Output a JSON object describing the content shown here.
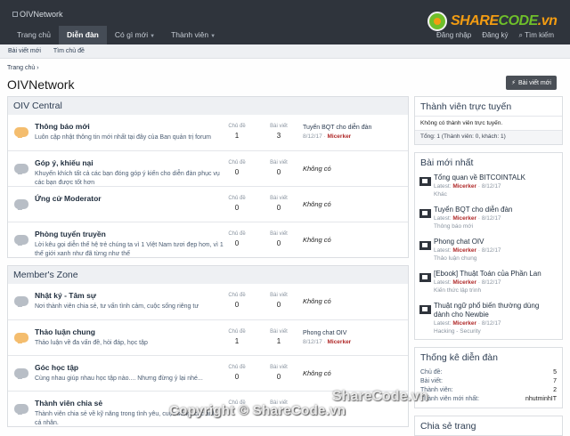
{
  "header": {
    "logo_alt": "OIVNetwork",
    "nav_tabs": [
      {
        "label": "Trang chủ",
        "active": false,
        "caret": false
      },
      {
        "label": "Diễn đàn",
        "active": true,
        "caret": false
      },
      {
        "label": "Có gì mới",
        "active": false,
        "caret": true
      },
      {
        "label": "Thành viên",
        "active": false,
        "caret": true
      }
    ],
    "login_label": "Đăng nhập",
    "register_label": "Đăng ký",
    "search_label": "Tìm kiếm",
    "sharecode_logo": {
      "part1": "SHARE",
      "part2": "CODE",
      "suffix": ".vn"
    }
  },
  "subnav": {
    "items": [
      "Bài viết mới",
      "Tìm chủ đề"
    ]
  },
  "breadcrumb": {
    "home": "Trang chủ"
  },
  "page": {
    "title": "OIVNetwork",
    "new_post_label": "Bài viết mới"
  },
  "categories": [
    {
      "name": "OIV Central",
      "forums": [
        {
          "title": "Thông báo mới",
          "desc": "Luôn cập nhật thông tin mới nhất tại đây của Ban quản trị forum",
          "unread": true,
          "threads_label": "Chủ đề",
          "threads": "1",
          "posts_label": "Bài viết",
          "posts": "3",
          "latest_title": "Tuyển BQT cho diễn đàn",
          "latest_date": "8/12/17",
          "latest_author": "Micerker",
          "none_label": ""
        },
        {
          "title": "Góp ý, khiếu nại",
          "desc": "Khuyến khích tất cả các bạn đóng góp ý kiến cho diễn đàn phục vụ các bạn được tốt hơn",
          "unread": false,
          "threads_label": "Chủ đề",
          "threads": "0",
          "posts_label": "Bài viết",
          "posts": "0",
          "latest_title": "",
          "latest_date": "",
          "latest_author": "",
          "none_label": "Không có"
        },
        {
          "title": "Ứng cử Moderator",
          "desc": "",
          "unread": false,
          "threads_label": "Chủ đề",
          "threads": "0",
          "posts_label": "Bài viết",
          "posts": "0",
          "latest_title": "",
          "latest_date": "",
          "latest_author": "",
          "none_label": "Không có"
        },
        {
          "title": "Phòng tuyển truyền",
          "desc": "Lời kêu gọi diễn thế hệ trẻ chúng ta vì 1 Việt Nam tươi đẹp hơn, vì 1 thế giới xanh như đã từng như thế",
          "unread": false,
          "threads_label": "Chủ đề",
          "threads": "0",
          "posts_label": "Bài viết",
          "posts": "0",
          "latest_title": "",
          "latest_date": "",
          "latest_author": "",
          "none_label": "Không có"
        }
      ]
    },
    {
      "name": "Member's Zone",
      "forums": [
        {
          "title": "Nhật ký - Tâm sự",
          "desc": "Nơi thành viên chia sẻ, tư vấn tình cảm, cuộc sống riêng tư",
          "unread": false,
          "threads_label": "Chủ đề",
          "threads": "0",
          "posts_label": "Bài viết",
          "posts": "0",
          "latest_title": "",
          "latest_date": "",
          "latest_author": "",
          "none_label": "Không có"
        },
        {
          "title": "Thảo luận chung",
          "desc": "Thảo luận về đa vấn đề, hỏi đáp, học tập",
          "unread": true,
          "threads_label": "Chủ đề",
          "threads": "1",
          "posts_label": "Bài viết",
          "posts": "1",
          "latest_title": "Phong chat OIV",
          "latest_date": "8/12/17",
          "latest_author": "Micerker",
          "none_label": ""
        },
        {
          "title": "Góc học tập",
          "desc": "Cùng nhau giúp nhau học tập nào.... Nhưng đừng ỷ lại nhé...",
          "unread": false,
          "threads_label": "Chủ đề",
          "threads": "0",
          "posts_label": "Bài viết",
          "posts": "0",
          "latest_title": "",
          "latest_date": "",
          "latest_author": "",
          "none_label": "Không có"
        },
        {
          "title": "Thành viên chia sẻ",
          "desc": "Thành viên chia sẻ về kỹ năng trong tình yêu, cuộc sống, các ảnh cá nhân.",
          "unread": false,
          "threads_label": "Chủ đề",
          "threads": "",
          "posts_label": "Bài viết",
          "posts": "",
          "latest_title": "",
          "latest_date": "",
          "latest_author": "",
          "none_label": ""
        }
      ]
    }
  ],
  "sidebar": {
    "online": {
      "title": "Thành viên trực tuyến",
      "empty": "Không có thành viên trực tuyến.",
      "footer": "Tổng: 1 (Thành viên: 0, khách: 1)"
    },
    "latest_posts": {
      "title": "Bài mới nhất",
      "items": [
        {
          "title": "Tổng quan về BITCOINTALK",
          "latest": "Latest:",
          "author": "Micerker",
          "date": "· 8/12/17",
          "forum": "Khác"
        },
        {
          "title": "Tuyển BQT cho diễn đàn",
          "latest": "Latest:",
          "author": "Micerker",
          "date": "· 8/12/17",
          "forum": "Thông báo mới"
        },
        {
          "title": "Phong chat OIV",
          "latest": "Latest:",
          "author": "Micerker",
          "date": "· 8/12/17",
          "forum": "Thảo luận chung"
        },
        {
          "title": "[Ebook] Thuật Toán của Phần Lan",
          "latest": "Latest:",
          "author": "Micerker",
          "date": "· 8/12/17",
          "forum": "Kiến thức lập trình"
        },
        {
          "title": "Thuật ngữ phổ biến thường dùng dành cho Newbie",
          "latest": "Latest:",
          "author": "Micerker",
          "date": "· 8/12/17",
          "forum": "Hacking - Security"
        }
      ]
    },
    "stats": {
      "title": "Thống kê diễn đàn",
      "rows": [
        {
          "label": "Chủ đề:",
          "value": "5"
        },
        {
          "label": "Bài viết:",
          "value": "7"
        },
        {
          "label": "Thành viên:",
          "value": "2"
        },
        {
          "label": "Thành viên mới nhất:",
          "value": "nhutminhIT"
        }
      ]
    },
    "share": {
      "title": "Chia sẻ trang"
    }
  },
  "watermark": {
    "copyright": "Copyright © ShareCode.vn",
    "site": "ShareCode.vn"
  }
}
